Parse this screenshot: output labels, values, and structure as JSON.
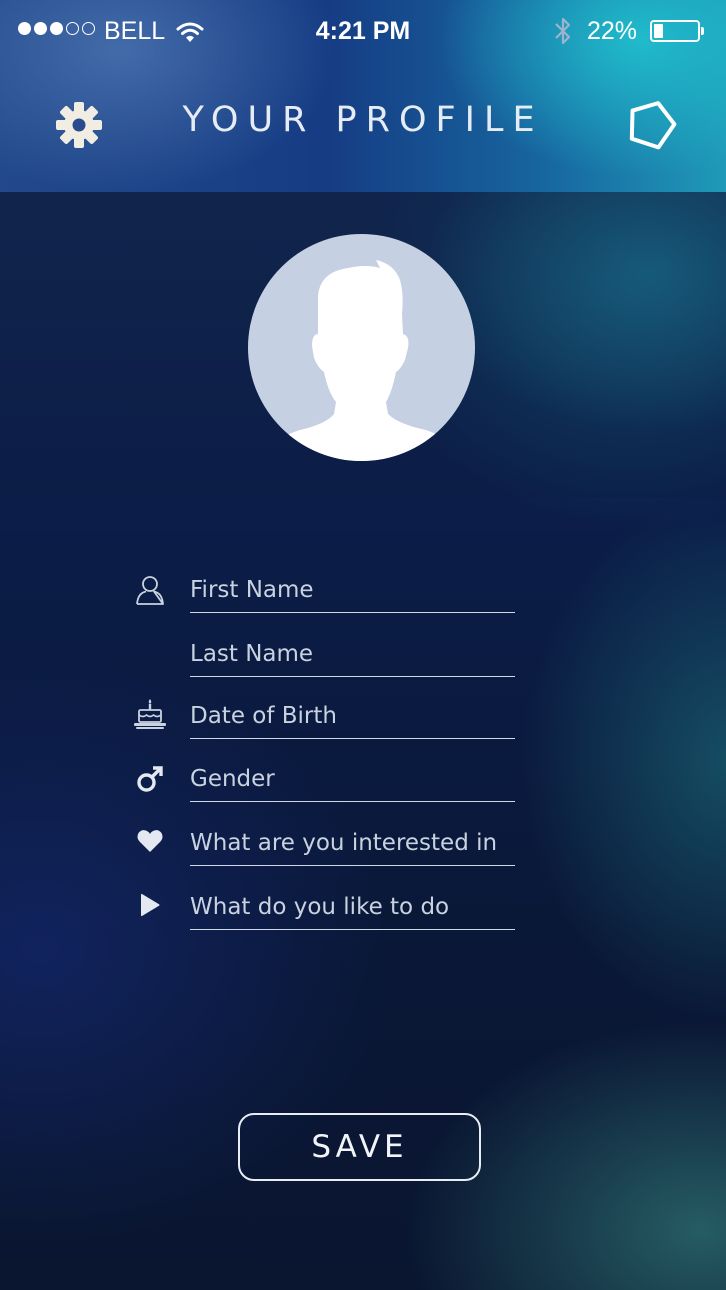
{
  "status_bar": {
    "signal_dots_filled": 3,
    "signal_dots_total": 5,
    "carrier": "BELL",
    "time": "4:21 PM",
    "battery_percent_label": "22%",
    "battery_level": 0.22
  },
  "header": {
    "title": "YOUR PROFILE",
    "left_icon": "gear-icon",
    "right_icon": "pentagon-icon"
  },
  "avatar": {
    "icon": "person-silhouette-icon"
  },
  "form": {
    "fields": [
      {
        "placeholder": "First Name",
        "icon": "person-icon"
      },
      {
        "placeholder": "Last Name",
        "icon": ""
      },
      {
        "placeholder": "Date of Birth",
        "icon": "birthday-cake-icon"
      },
      {
        "placeholder": "Gender",
        "icon": "male-symbol-icon"
      },
      {
        "placeholder": "What are you interested in",
        "icon": "heart-icon"
      },
      {
        "placeholder": "What do you like to do",
        "icon": "play-icon"
      }
    ]
  },
  "save_label": "SAVE",
  "colors": {
    "header_accent": "#1f9ab8",
    "background": "#0b1d48",
    "text": "#dfe6f0"
  }
}
